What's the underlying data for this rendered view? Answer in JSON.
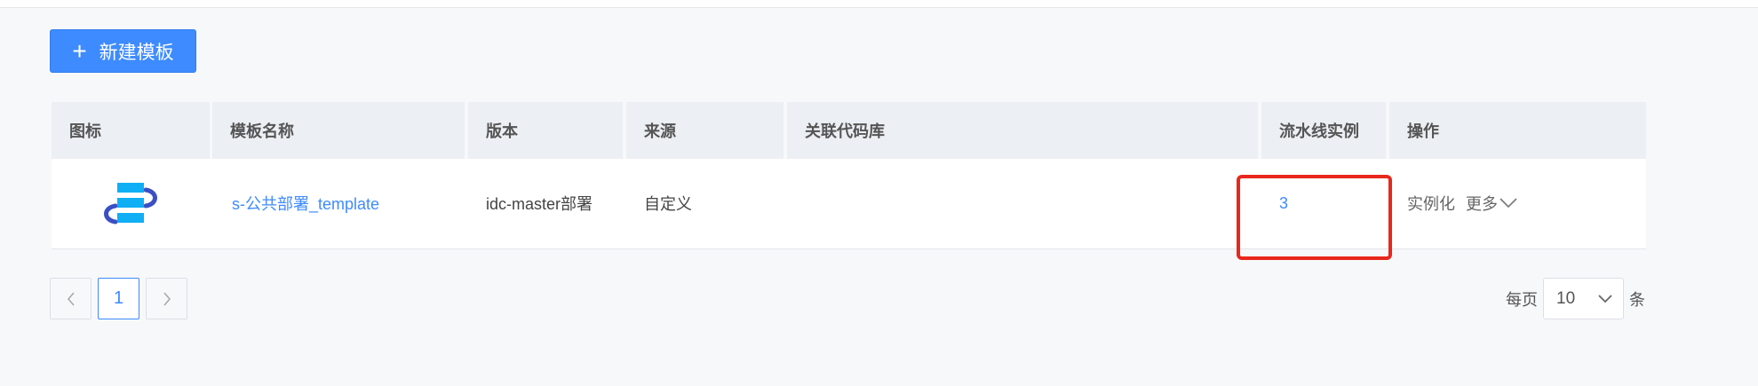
{
  "toolbar": {
    "new_template_label": "新建模板"
  },
  "table": {
    "headers": [
      "图标",
      "模板名称",
      "版本",
      "来源",
      "关联代码库",
      "流水线实例",
      "操作"
    ],
    "rows": [
      {
        "icon": "pipeline-template-icon",
        "name": "s-公共部署_template",
        "version": "idc-master部署",
        "source": "自定义",
        "repo": "",
        "instances": "3",
        "actions": {
          "instantiate": "实例化",
          "more": "更多"
        }
      }
    ]
  },
  "pagination": {
    "current_page": "1",
    "per_page_prefix": "每页",
    "per_page_value": "10",
    "per_page_suffix": "条"
  },
  "colors": {
    "accent": "#3e8bff",
    "highlight": "#e8271d",
    "icon_blue": "#10aef5",
    "icon_dark": "#3b4fc4"
  }
}
